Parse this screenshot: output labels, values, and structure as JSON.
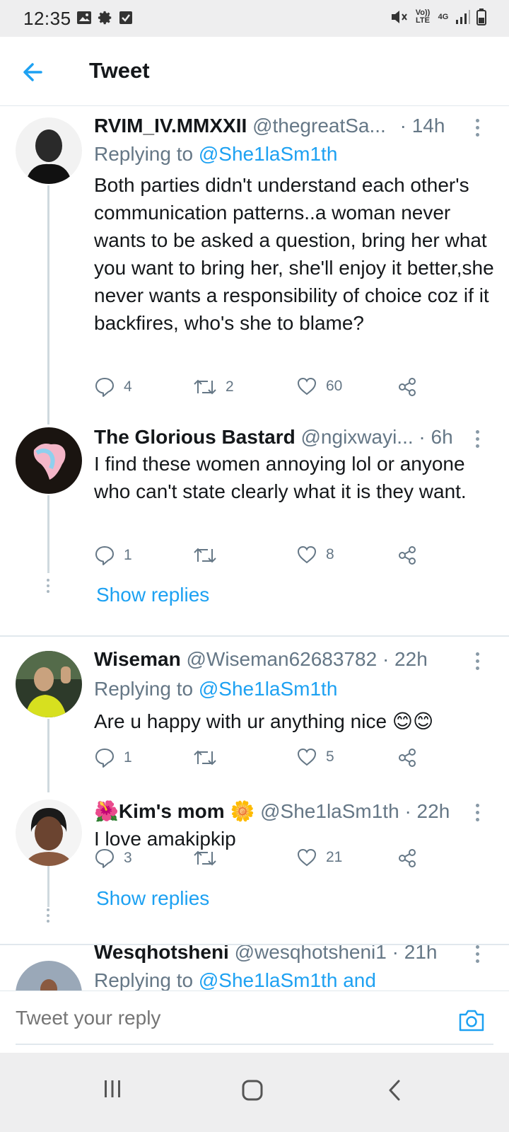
{
  "status_bar": {
    "time": "12:35",
    "left_icons": [
      "image-icon",
      "gear-icon",
      "checkbox-icon"
    ],
    "volte": "Vo)) LTE",
    "network": "4G",
    "right_icons": [
      "mute-icon",
      "signal-icon",
      "battery-icon"
    ]
  },
  "header": {
    "title": "Tweet",
    "back_icon": "arrow-left-icon"
  },
  "tweets": [
    {
      "name": "RVIM_IV.MMXXII",
      "handle": "@thegreatSa...",
      "time": "· 14h",
      "replying_prefix": "Replying to ",
      "replying_to": "@She1laSm1th",
      "text": "Both parties didn't understand each other's communication patterns..a woman never wants to be asked a question, bring her what you want to bring her, she'll enjoy it better,she never wants a responsibility of choice coz if it backfires, who's she to blame?",
      "replies": "4",
      "retweets": "2",
      "likes": "60"
    },
    {
      "name": "The Glorious Bastard",
      "handle": "@ngixwayi...",
      "time": "· 6h",
      "text": "I find these women annoying lol or anyone who can't state clearly what it is they want.",
      "replies": "1",
      "retweets": "",
      "likes": "8",
      "show_replies": "Show replies"
    },
    {
      "name": "Wiseman",
      "handle": "@Wiseman62683782",
      "time": "· 22h",
      "replying_prefix": "Replying to ",
      "replying_to": "@She1laSm1th",
      "text": "Are u happy with ur anything nice 😊😊",
      "replies": "1",
      "retweets": "",
      "likes": "5"
    },
    {
      "name_prefix": "🌺",
      "name": "Kim's mom",
      "name_suffix": "🌼",
      "handle": "@She1laSm1th",
      "time": "· 22h",
      "text": "I love amakipkip",
      "replies": "3",
      "retweets": "",
      "likes": "21",
      "show_replies": "Show replies"
    },
    {
      "name": "Wesqhotsheni",
      "handle": "@wesqhotsheni1",
      "time": "· 21h",
      "replying_prefix": "Replying to ",
      "replying_to": "@She1laSm1th and"
    }
  ],
  "reply_bar": {
    "placeholder": "Tweet your reply",
    "camera_icon": "camera-icon"
  },
  "nav_bar": {
    "icons": [
      "recents-icon",
      "home-icon",
      "back-icon"
    ]
  },
  "colors": {
    "accent": "#1da1f2",
    "secondary_text": "#657786",
    "divider": "#e1e8ed"
  }
}
